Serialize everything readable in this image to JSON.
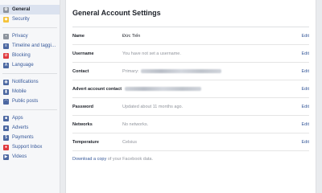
{
  "sidebar": {
    "groups": [
      [
        {
          "label": "General",
          "icon": "gear-icon",
          "color": "#8d949e",
          "active": true
        },
        {
          "label": "Security",
          "icon": "shield-icon",
          "color": "#f5c33b",
          "active": false
        }
      ],
      [
        {
          "label": "Privacy",
          "icon": "lock-icon",
          "color": "#8d949e",
          "active": false
        },
        {
          "label": "Timeline and taggi…",
          "icon": "timeline-icon",
          "color": "#4b67a1",
          "active": false
        },
        {
          "label": "Blocking",
          "icon": "block-icon",
          "color": "#e0393e",
          "active": false
        },
        {
          "label": "Language",
          "icon": "language-icon",
          "color": "#4b67a1",
          "active": false
        }
      ],
      [
        {
          "label": "Notifications",
          "icon": "globe-icon",
          "color": "#4b67a1",
          "active": false
        },
        {
          "label": "Mobile",
          "icon": "mobile-icon",
          "color": "#4b67a1",
          "active": false
        },
        {
          "label": "Public posts",
          "icon": "rss-icon",
          "color": "#4b67a1",
          "active": false
        }
      ],
      [
        {
          "label": "Apps",
          "icon": "apps-icon",
          "color": "#4b67a1",
          "active": false
        },
        {
          "label": "Adverts",
          "icon": "adverts-icon",
          "color": "#4b67a1",
          "active": false
        },
        {
          "label": "Payments",
          "icon": "payments-icon",
          "color": "#4b67a1",
          "active": false
        },
        {
          "label": "Support Inbox",
          "icon": "support-icon",
          "color": "#e0393e",
          "active": false
        },
        {
          "label": "Videos",
          "icon": "video-icon",
          "color": "#4b67a1",
          "active": false
        }
      ]
    ]
  },
  "main": {
    "title": "General Account Settings",
    "rows": [
      {
        "label": "Name",
        "value": "Đức Tiến",
        "style": "dark",
        "redacted": false,
        "edit": "Edit"
      },
      {
        "label": "Username",
        "value": "You have not set a username.",
        "style": "muted",
        "redacted": false,
        "edit": "Edit"
      },
      {
        "label": "Contact",
        "value": "Primary:",
        "style": "muted",
        "redacted": true,
        "edit": "Edit"
      },
      {
        "label": "Advert account contact",
        "value": "",
        "style": "muted",
        "redacted": true,
        "edit": "Edit"
      },
      {
        "label": "Password",
        "value": "Updated about 11 months ago.",
        "style": "muted",
        "redacted": false,
        "edit": "Edit"
      },
      {
        "label": "Networks",
        "value": "No networks.",
        "style": "muted",
        "redacted": false,
        "edit": "Edit"
      },
      {
        "label": "Temperature",
        "value": "Celsius",
        "style": "muted",
        "redacted": false,
        "edit": "Edit"
      }
    ],
    "download_link": "Download a copy",
    "download_rest": " of your Facebook data."
  }
}
